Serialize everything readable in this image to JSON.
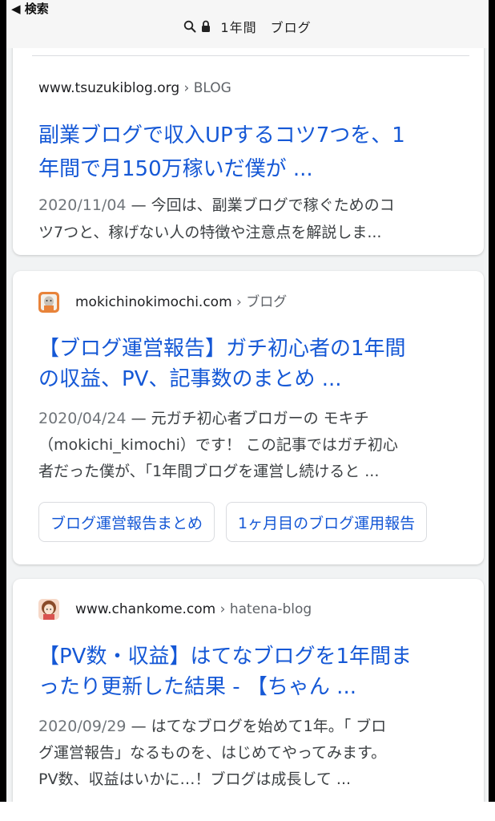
{
  "topbar": {
    "back_label": "◀ 検索",
    "address_text": "1年間　ブログ",
    "search_icon": "search-icon",
    "lock_icon": "lock-icon"
  },
  "results": [
    {
      "site": "www.tsuzukiblog.org",
      "crumb": "› BLOG",
      "title_lines": [
        "副業ブログで収入UPするコツ7つを、1",
        "年間で月150万稼いだ僕が ..."
      ],
      "date": "2020/11/04",
      "snippet_lines": [
        "今回は、副業ブログで稼ぐためのコ",
        "ツ7つと、稼げない人の特徴や注意点を解説しま..."
      ]
    },
    {
      "site": "mokichinokimochi.com",
      "crumb": "› ブログ",
      "title_lines": [
        "【ブログ運営報告】ガチ初心者の1年間",
        "の収益、PV、記事数のまとめ ..."
      ],
      "date": "2020/04/24",
      "snippet_lines": [
        "元ガチ初心者ブロガーの モキチ",
        "（mokichi_kimochi）です！ この記事ではガチ初心",
        "者だった僕が、「1年間ブログを運営し続けると ..."
      ],
      "chips": [
        "ブログ運営報告まとめ",
        "1ヶ月目のブログ運用報告"
      ]
    },
    {
      "site": "www.chankome.com",
      "crumb": "› hatena-blog",
      "title_lines": [
        "【PV数・収益】はてなブログを1年間ま",
        "ったり更新した結果 - 【ちゃん ..."
      ],
      "date": "2020/09/29",
      "snippet_lines": [
        "はてなブログを始めて1年。「 ブロ",
        "グ運営報告」なるものを、はじめてやってみます。",
        "PV数、収益はいかに…！ブログは成長して ..."
      ]
    }
  ],
  "colors": {
    "link": "#1558d6",
    "text": "#3c4043",
    "muted": "#70757a",
    "background": "#f1f3f4"
  }
}
